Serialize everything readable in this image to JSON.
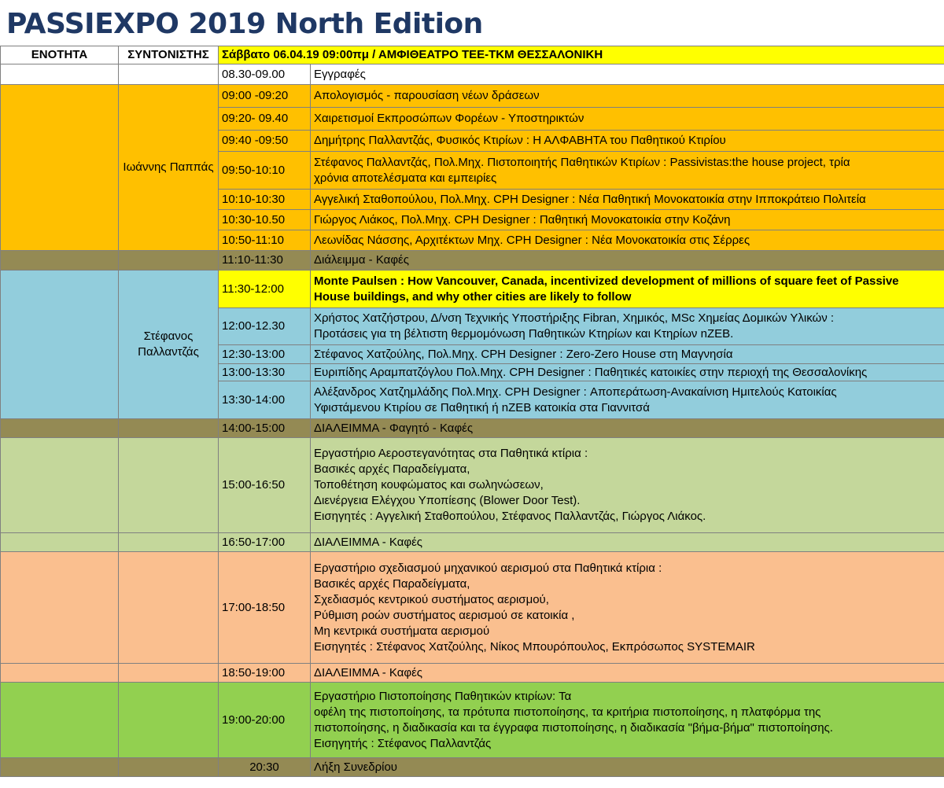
{
  "title": "PASSIEXPO 2019 North Edition",
  "header": {
    "unit": "ΕΝΟΤΗΤΑ",
    "moderator": "ΣΥΝΤΟΝΙΣΤΗΣ",
    "session": "Σάββατο 06.04.19  09:00πμ /  ΑΜΦΙΘΕΑΤΡΟ ΤΕΕ-ΤΚΜ ΘΕΣΣΑΛΟΝΙΚΗ"
  },
  "colors": {
    "yellow": "#ffff00",
    "orange": "#ffc000",
    "break": "#948a54",
    "blue": "#92cddc",
    "sage": "#c4d79b",
    "peach": "#fabf8f",
    "green": "#92d050",
    "title": "#1f3864"
  },
  "groups": {
    "g1": {
      "moderator": "Ιωάννης Παππάς"
    },
    "g2": {
      "moderator_lines": [
        "Στέφανος",
        "Παλλαντζάς"
      ]
    }
  },
  "rows": {
    "r00": {
      "time": "08.30-09.00",
      "desc": [
        "Εγγραφές"
      ]
    },
    "r01": {
      "time": "09:00 -09:20",
      "desc": [
        "Απολογισμός - παρουσίαση νέων δράσεων"
      ]
    },
    "r02": {
      "time": "09:20- 09.40",
      "desc": [
        "Χαιρετισμοί Εκπροσώπων Φορέων - Υποστηρικτών"
      ]
    },
    "r03": {
      "time": "09:40 -09:50",
      "desc": [
        "Δημήτρης Παλλαντζάς, Φυσικός Κτιρίων : Η ΑΛΦΑΒΗΤΑ του Παθητικού Κτιρίου"
      ]
    },
    "r04": {
      "time": "09:50-10:10",
      "desc": [
        "Στέφανος Παλλαντζάς, Πολ.Μηχ. Πιστοποιητής Παθητικών Κτιρίων : Passivistas:the house project, τρία",
        "χρόνια αποτελέσματα και εμπειρίες"
      ]
    },
    "r05": {
      "time": "10:10-10:30",
      "desc": [
        "Αγγελική Σταθοπούλου, Πολ.Μηχ. CPH Designer : Νέα Παθητική Μονοκατοικία στην Ιπποκράτειο Πολιτεία"
      ]
    },
    "r06": {
      "time": "10:30-10.50",
      "desc": [
        "Γιώργος Λιάκος, Πολ.Μηχ. CPH Designer : Παθητική Μονοκατοικία στην Κοζάνη"
      ]
    },
    "r07": {
      "time": "10:50-11:10",
      "desc": [
        "Λεωνίδας Νάσσης, Αρχιτέκτων Μηχ. CPH Designer : Νέα  Μονοκατοικία στις Σέρρες"
      ]
    },
    "r08": {
      "time": "11:10-11:30",
      "desc": [
        "Διάλειμμα - Καφές"
      ]
    },
    "r09": {
      "time": "11:30-12:00",
      "desc": [
        "Monte Paulsen : How Vancouver, Canada, incentivized development of millions of square feet of Passive",
        "House buildings, and why other cities are likely to follow"
      ]
    },
    "r10": {
      "time": "12:00-12.30",
      "desc": [
        "Χρήστος Χατζήστρου, Δ/νση Τεχνικής Υποστήριξης Fibran, Χημικός, MSc Χημείας Δομικών Υλικών :",
        "Προτάσεις για τη βέλτιστη θερμομόνωση Παθητικών Κτηρίων και Κτηρίων nZEB."
      ]
    },
    "r11": {
      "time": "12:30-13:00",
      "desc": [
        "Στέφανος Χατζούλης, Πολ.Μηχ. CPH Designer : Zero-Zero House στη Μαγνησία"
      ]
    },
    "r12": {
      "time": "13:00-13:30",
      "desc": [
        "Ευριπίδης Αραμπατζόγλου Πολ.Μηχ. CPH Designer : Παθητικές κατοικίες στην περιοχή της Θεσσαλονίκης"
      ]
    },
    "r13": {
      "time": "13:30-14:00",
      "desc": [
        "Αλέξανδρος Χατζημλάδης Πολ.Μηχ. CPH Designer : Αποπεράτωση-Ανακαίνιση Ημιτελούς Κατοικίας",
        "Υφιστάμενου Κτιρίου σε Παθητική ή nZEB κατοικία στα Γιαννιτσά"
      ]
    },
    "r14": {
      "time": "14:00-15:00",
      "desc": [
        "ΔΙΑΛΕΙΜΜΑ - Φαγητό - Καφές"
      ]
    },
    "r15": {
      "time": "15:00-16:50",
      "desc": [
        "Εργαστήριο Αεροστεγανότητας στα Παθητικά κτίρια :",
        "Βασικές αρχές Παραδείγματα,",
        "Τοποθέτηση κουφώματος και σωληνώσεων,",
        "Διενέργεια Ελέγχου Υποπίεσης (Blower Door Test).",
        "Εισηγητές : Αγγελική Σταθοπούλου, Στέφανος Παλλαντζάς, Γιώργος Λιάκος."
      ]
    },
    "r16": {
      "time": "16:50-17:00",
      "desc": [
        "ΔΙΑΛΕΙΜΜΑ - Καφές"
      ]
    },
    "r17": {
      "time": "17:00-18:50",
      "desc": [
        "Εργαστήριο σχεδιασμού μηχανικού αερισμού στα Παθητικά κτίρια :",
        "Βασικές αρχές Παραδείγματα,",
        "Σχεδιασμός κεντρικού συστήματος αερισμού,",
        "Ρύθμιση ροών συστήματος αερισμού σε κατοικία ,",
        "Μη κεντρικά συστήματα αερισμού",
        "Εισηγητές : Στέφανος Χατζούλης, Νίκος Μπουρόπουλος, Εκπρόσωπος SYSTEMAIR"
      ]
    },
    "r18": {
      "time": "18:50-19:00",
      "desc": [
        "ΔΙΑΛΕΙΜΜΑ - Καφές"
      ]
    },
    "r19": {
      "time": "19:00-20:00",
      "desc_first": "Εργαστήριο Πιστοποίησης Παθητικών κτιρίων:",
      "desc_first_right": "Τα",
      "desc": [
        "οφέλη της πιστοποίησης, τα πρότυπα πιστοποίησης, τα κριτήρια πιστοποίησης, η πλατφόρμα της",
        "πιστοποίησης, η διαδικασία και τα έγγραφα πιστοποίησης, η διαδικασία \"βήμα-βήμα\" πιστοποίησης.",
        "Εισηγητής : Στέφανος Παλλαντζάς"
      ]
    },
    "r20": {
      "time": "20:30",
      "desc": [
        "Λήξη Συνεδρίου"
      ]
    }
  }
}
